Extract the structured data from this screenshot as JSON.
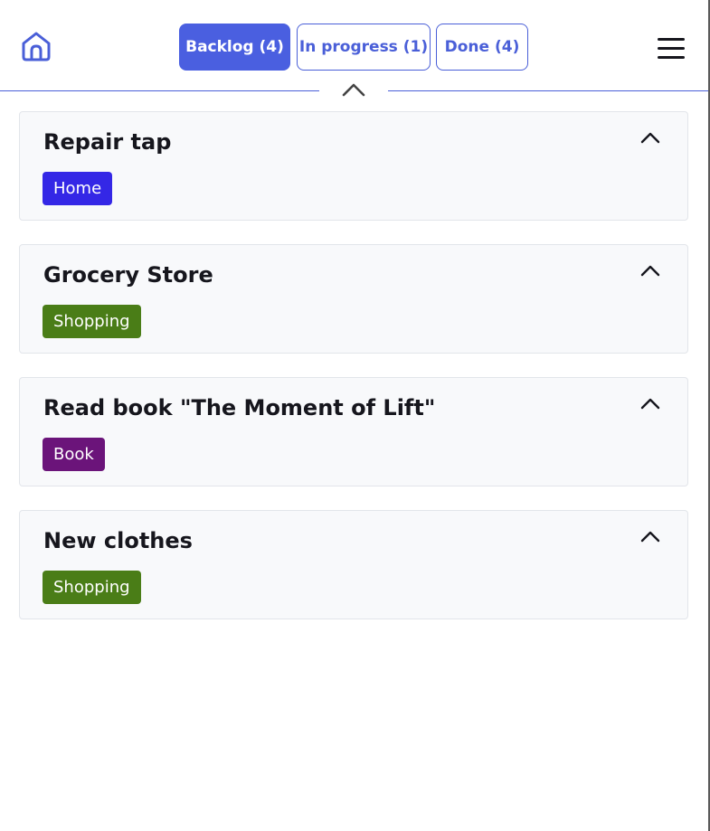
{
  "header": {
    "tabs": [
      {
        "label": "Backlog (4)",
        "active": true
      },
      {
        "label": "In progress (1)",
        "active": false
      },
      {
        "label": "Done (4)",
        "active": false
      }
    ]
  },
  "colors": {
    "accent": "#4a5fe0",
    "tag_home": "#3427e6",
    "tag_shopping": "#4a7d17",
    "tag_book": "#6b147a"
  },
  "icons": {
    "home": "home-icon",
    "menu": "hamburger-menu-icon",
    "collapse": "chevron-up-icon"
  },
  "cards": [
    {
      "title": "Repair tap",
      "tag": "Home"
    },
    {
      "title": "Grocery Store",
      "tag": "Shopping"
    },
    {
      "title": "Read book \"The Moment of Lift\"",
      "tag": "Book"
    },
    {
      "title": "New clothes",
      "tag": "Shopping"
    }
  ]
}
